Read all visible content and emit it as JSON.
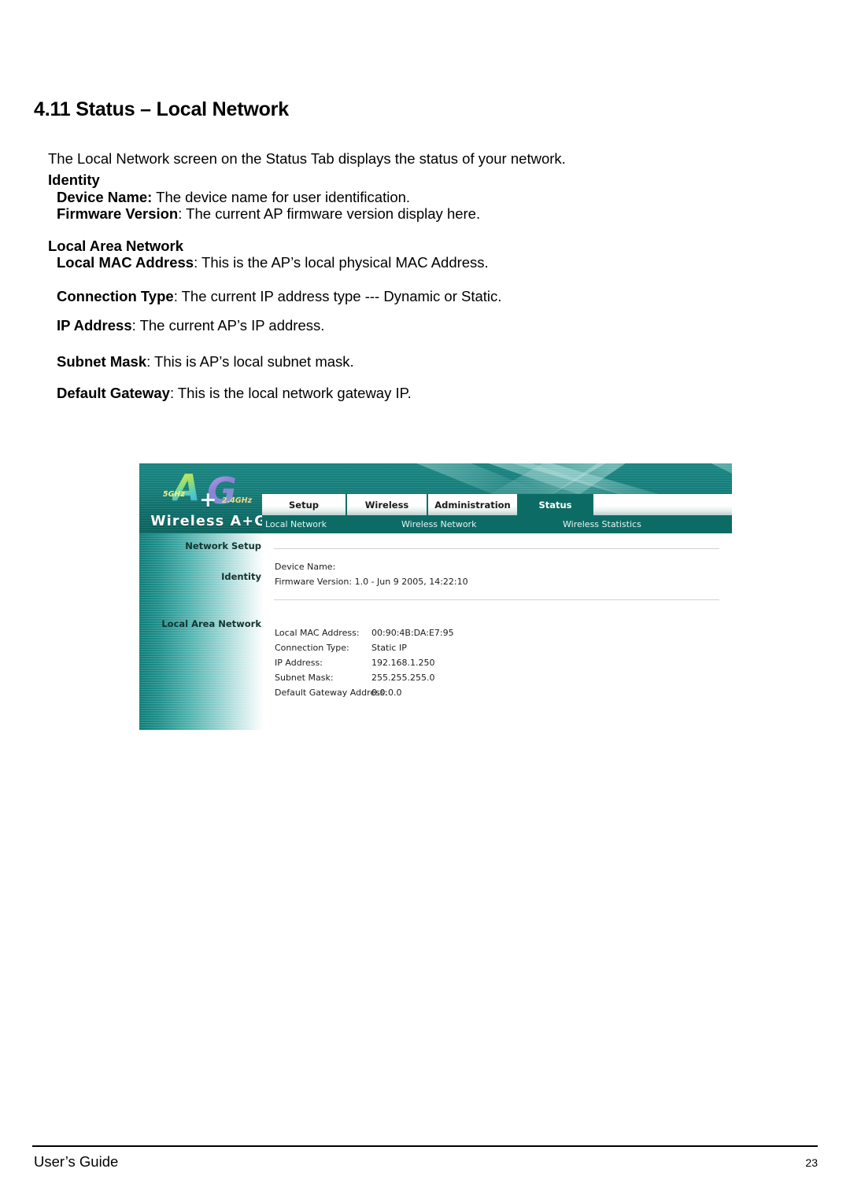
{
  "document": {
    "section_number": "4.11",
    "section_title": "4.11 Status – Local Network",
    "intro": "The Local Network screen on the Status Tab displays the status of your network.",
    "groups": [
      {
        "heading": "Identity",
        "definitions": [
          {
            "term": "Device Name:",
            "description": " The device name for user identification."
          },
          {
            "term": "Firmware Version",
            "description": ": The current AP firmware version display here."
          }
        ]
      },
      {
        "heading": "Local Area Network",
        "definitions": [
          {
            "term": "Local MAC Address",
            "description": ": This is the AP’s local physical MAC Address."
          },
          {
            "term": "Connection Type",
            "description": ": The current IP address type --- Dynamic or Static."
          },
          {
            "term": "IP Address",
            "description": ": The current AP’s IP address."
          },
          {
            "term": "Subnet Mask",
            "description": ": This is AP’s local subnet mask."
          },
          {
            "term": "Default Gateway",
            "description": ": This is the local network gateway IP."
          }
        ]
      }
    ]
  },
  "screenshot": {
    "brand": {
      "letter_a": "A",
      "letter_g": "G",
      "plus": "+",
      "band_5ghz": "5GHz",
      "band_24ghz": "2.4GHz",
      "wordmark": "Wireless A+G"
    },
    "tabs": [
      {
        "label": "Setup",
        "active": false
      },
      {
        "label": "Wireless",
        "active": false
      },
      {
        "label": "Administration",
        "active": false
      },
      {
        "label": "Status",
        "active": true
      }
    ],
    "subnav": [
      {
        "label": "Local Network",
        "active": true
      },
      {
        "label": "Wireless Network",
        "active": false
      },
      {
        "label": "Wireless Statistics",
        "active": false
      }
    ],
    "sidebar": [
      {
        "label": "Network Setup"
      },
      {
        "label": "Identity"
      },
      {
        "label": "Local Area Network"
      }
    ],
    "identity": {
      "device_name_label": "Device Name:",
      "device_name_value": "",
      "firmware_label": "Firmware Version:",
      "firmware_value": "1.0 - Jun 9 2005, 14:22:10"
    },
    "lan": [
      {
        "key": "Local MAC Address:",
        "value": "00:90:4B:DA:E7:95"
      },
      {
        "key": "Connection Type:",
        "value": "Static IP"
      },
      {
        "key": "IP Address:",
        "value": "192.168.1.250"
      },
      {
        "key": "Subnet Mask:",
        "value": "255.255.255.0"
      },
      {
        "key": "Default Gateway Address:",
        "value": "0.0.0.0"
      }
    ],
    "colors": {
      "banner_teal": "#17827e",
      "active_tab": "#0d6b65",
      "sidebar_teal": "#0e7d79",
      "tab_text": "#1a1a1a",
      "subnav_text": "#e9f4f3"
    }
  },
  "footer": {
    "left": "User’s Guide",
    "page_number": "23"
  }
}
